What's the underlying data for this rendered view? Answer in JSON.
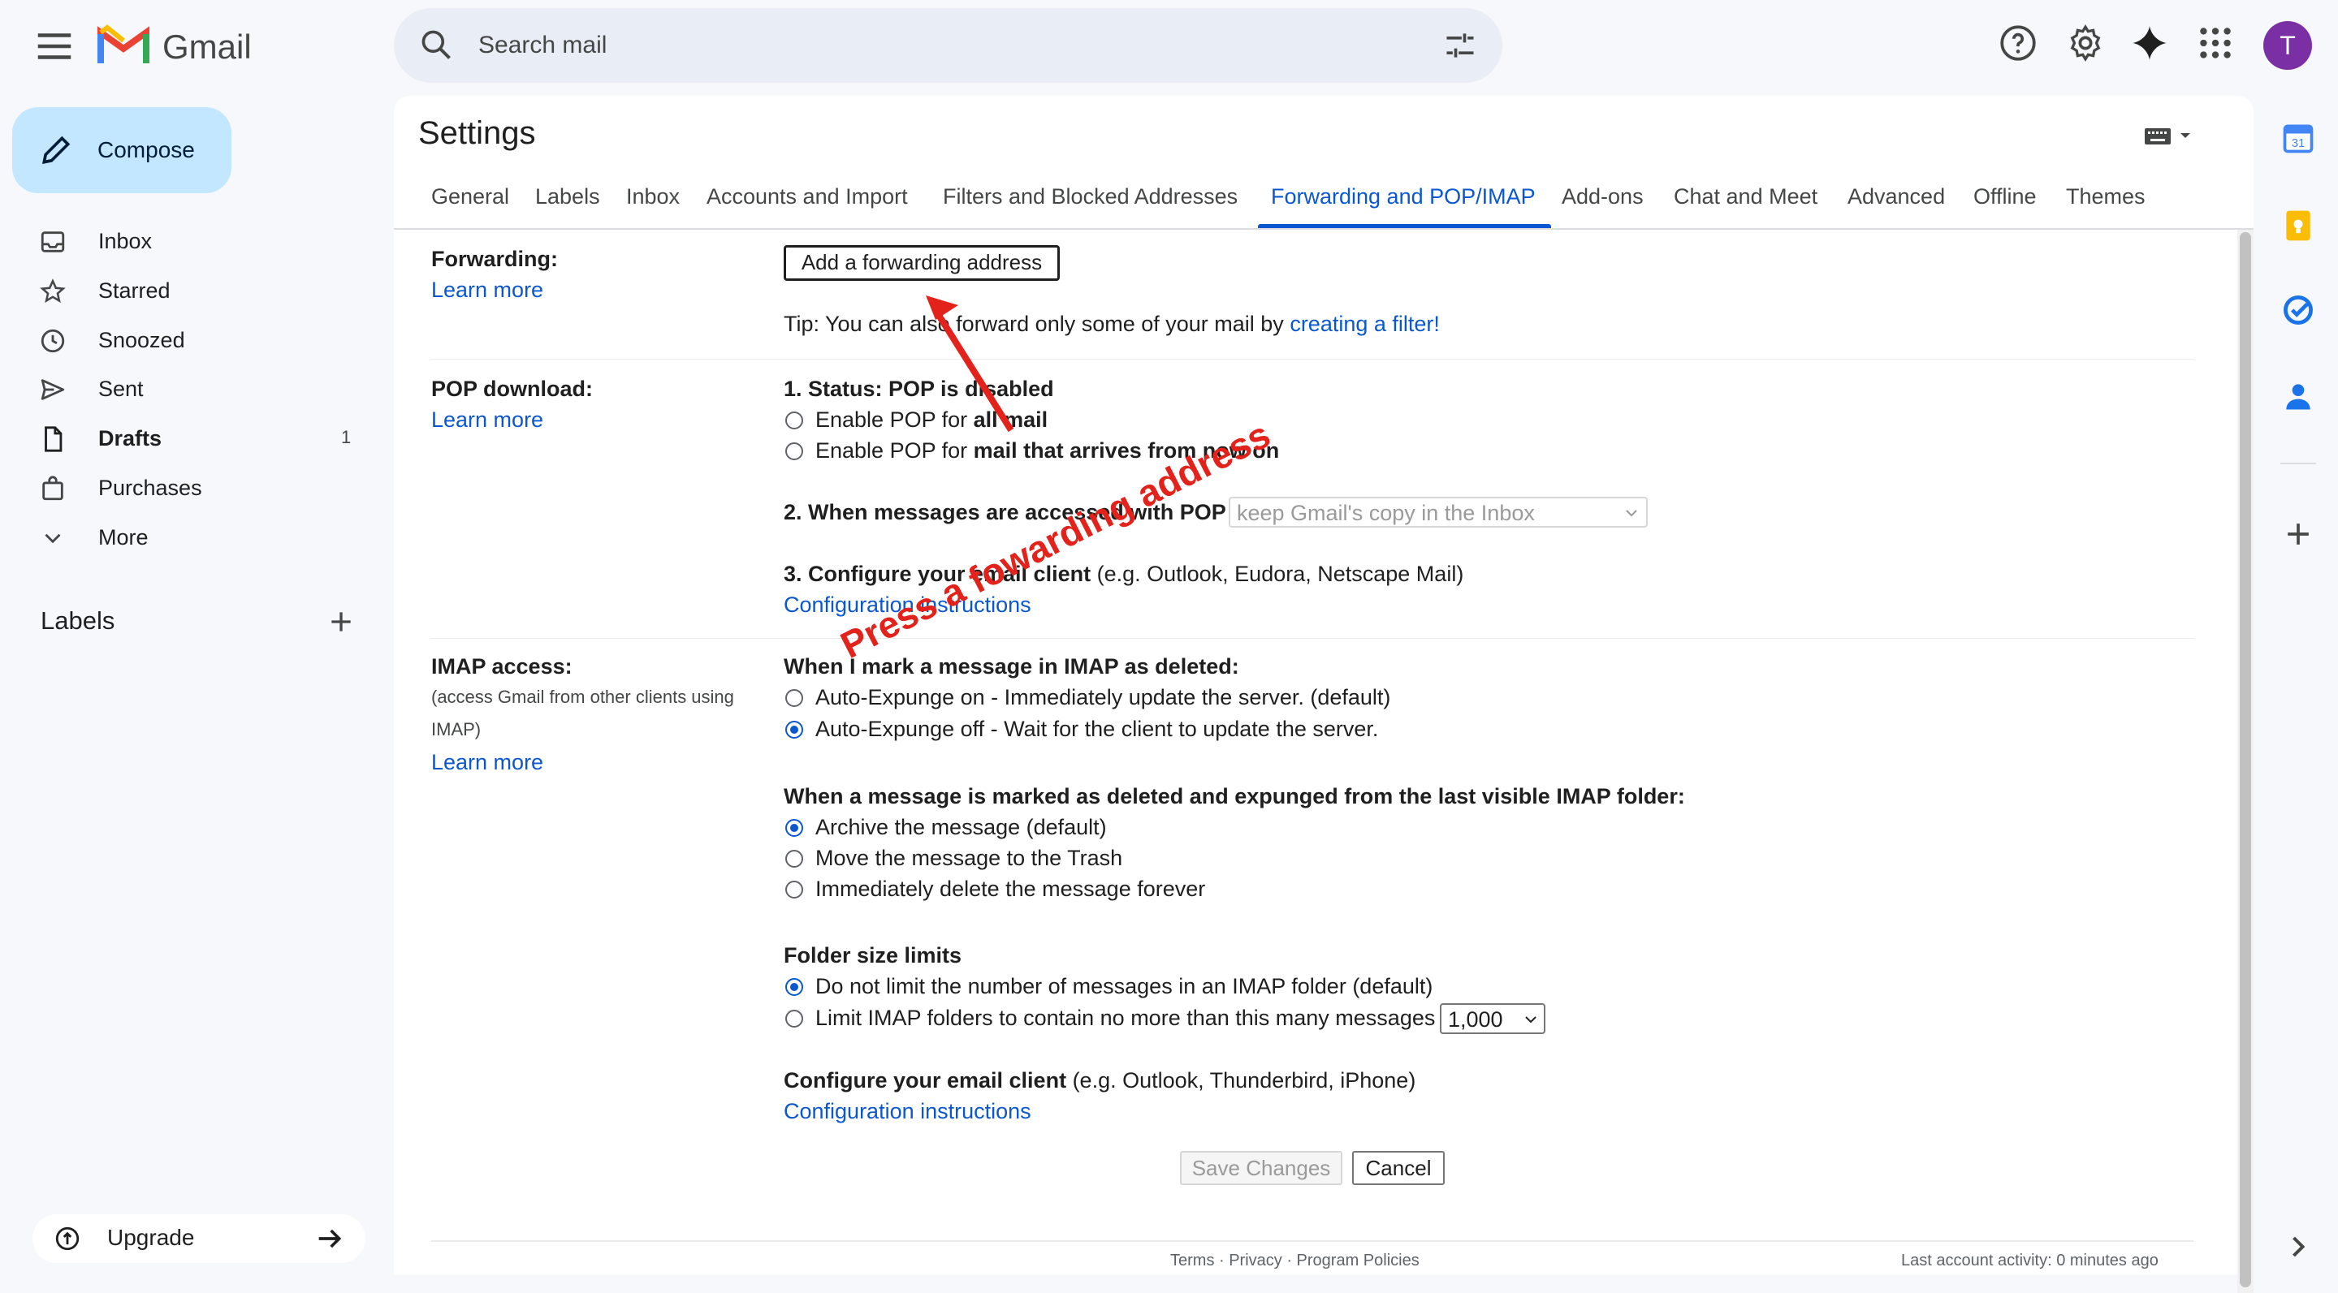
{
  "app": {
    "brand": "Gmail",
    "avatar_letter": "T"
  },
  "search": {
    "placeholder": "Search mail"
  },
  "sidebar": {
    "compose": "Compose",
    "items": [
      {
        "label": "Inbox",
        "count": ""
      },
      {
        "label": "Starred",
        "count": ""
      },
      {
        "label": "Snoozed",
        "count": ""
      },
      {
        "label": "Sent",
        "count": ""
      },
      {
        "label": "Drafts",
        "count": "1"
      },
      {
        "label": "Purchases",
        "count": ""
      },
      {
        "label": "More",
        "count": ""
      }
    ],
    "labels_heading": "Labels",
    "upgrade": "Upgrade"
  },
  "settings": {
    "title": "Settings",
    "tabs": [
      "General",
      "Labels",
      "Inbox",
      "Accounts and Import",
      "Filters and Blocked Addresses",
      "Forwarding and POP/IMAP",
      "Add-ons",
      "Chat and Meet",
      "Advanced",
      "Offline",
      "Themes"
    ],
    "active_tab": "Forwarding and POP/IMAP",
    "forwarding": {
      "heading": "Forwarding:",
      "learn_more": "Learn more",
      "add_button": "Add a forwarding address",
      "tip_prefix": "Tip: You can also forward only some of your mail by ",
      "tip_link": "creating a filter!"
    },
    "pop": {
      "heading": "POP download:",
      "learn_more": "Learn more",
      "status": "1. Status: POP is disabled",
      "opt1_prefix": "Enable POP for ",
      "opt1_bold": "all mail",
      "opt2_prefix": "Enable POP for ",
      "opt2_bold": "mail that arrives from now on",
      "when_accessed": "2. When messages are accessed with POP",
      "when_select": "keep Gmail's copy in the Inbox",
      "configure_bold": "3. Configure your email client",
      "configure_rest": " (e.g. Outlook, Eudora, Netscape Mail)",
      "config_link": "Configuration instructions"
    },
    "imap": {
      "heading": "IMAP access:",
      "sub1": "(access Gmail from other clients using",
      "sub2": "IMAP)",
      "learn_more": "Learn more",
      "deleted_heading": "When I mark a message in IMAP as deleted:",
      "deleted_opts": [
        "Auto-Expunge on - Immediately update the server. (default)",
        "Auto-Expunge off - Wait for the client to update the server."
      ],
      "expunged_heading": "When a message is marked as deleted and expunged from the last visible IMAP folder:",
      "expunged_opts": [
        "Archive the message (default)",
        "Move the message to the Trash",
        "Immediately delete the message forever"
      ],
      "folder_heading": "Folder size limits",
      "folder_opts": [
        "Do not limit the number of messages in an IMAP folder (default)",
        "Limit IMAP folders to contain no more than this many messages"
      ],
      "folder_limit_value": "1,000",
      "client_bold": "Configure your email client",
      "client_rest": " (e.g. Outlook, Thunderbird, iPhone)",
      "client_link": "Configuration instructions"
    },
    "save_button": "Save Changes",
    "cancel_button": "Cancel",
    "footer_links": "Terms · Privacy · Program Policies",
    "footer_activity": "Last account activity: 0 minutes ago"
  },
  "annotation": {
    "text": "Press a fowarding address",
    "color": "#e3231b"
  },
  "colors": {
    "accent": "#0b57d0",
    "compose_bg": "#c2e7ff",
    "avatar": "#7b2fa5"
  }
}
